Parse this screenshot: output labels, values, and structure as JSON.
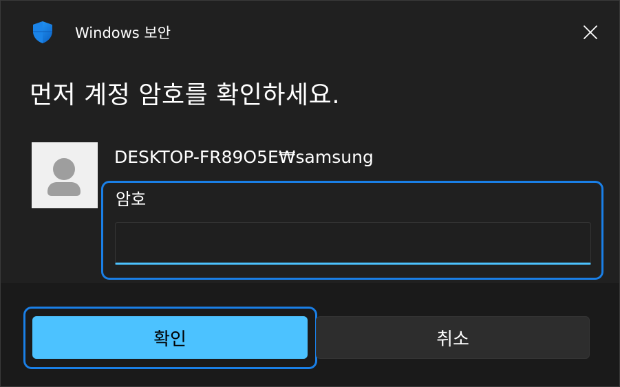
{
  "window": {
    "title": "Windows 보안",
    "close_icon": "close-icon",
    "app_icon": "windows-security-shield-icon",
    "accent_color": "#4cc2ff",
    "focus_color": "#1a7fe6"
  },
  "prompt": {
    "heading": "먼저 계정 암호를 확인하세요."
  },
  "account": {
    "avatar_icon": "user-avatar-icon",
    "name": "DESKTOP-FR89O5E₩samsung"
  },
  "password": {
    "label": "암호",
    "value": "",
    "placeholder": ""
  },
  "buttons": {
    "ok_label": "확인",
    "cancel_label": "취소"
  }
}
